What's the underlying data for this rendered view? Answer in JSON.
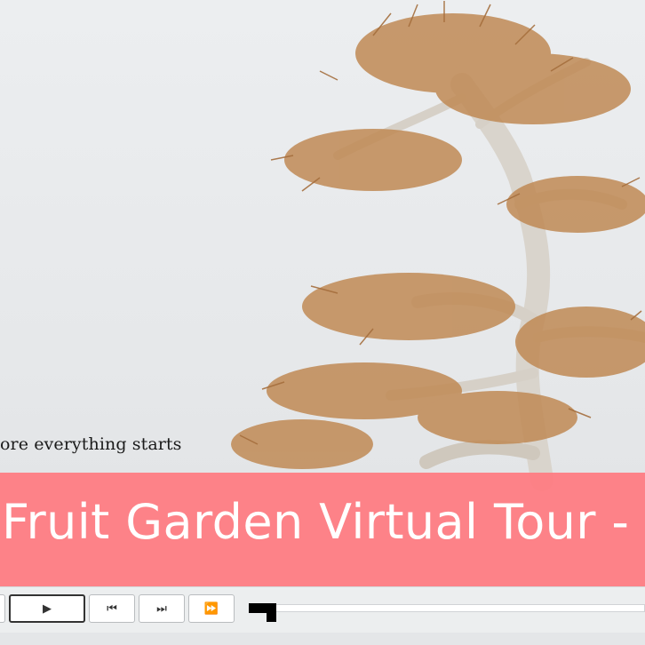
{
  "slide": {
    "caption": "ore everything starts",
    "title": "Fruit Garden Virtual Tour - "
  },
  "player": {
    "buttons": [
      {
        "name": "play",
        "icon": "play-icon",
        "glyph": "▶"
      },
      {
        "name": "previous",
        "icon": "skip-back-icon",
        "glyph": "⏮"
      },
      {
        "name": "next",
        "icon": "skip-forward-icon",
        "glyph": "⏭"
      },
      {
        "name": "fast-forward",
        "icon": "fast-forward-icon",
        "glyph": "⏩"
      }
    ],
    "progress_fraction": 0.07
  },
  "colors": {
    "title_band": "#ff7a80",
    "title_text": "#ffffff",
    "caption_text": "#1a1a1a",
    "tree_branch": "#b98550"
  }
}
